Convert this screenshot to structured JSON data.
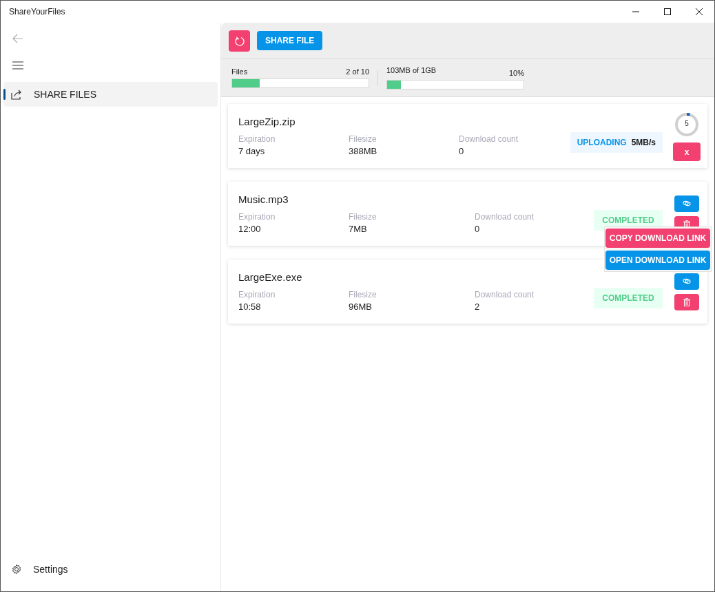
{
  "window": {
    "title": "ShareYourFiles"
  },
  "sidebar": {
    "items": [
      {
        "label": "SHARE FILES",
        "selected": true
      }
    ],
    "footer": {
      "label": "Settings"
    }
  },
  "toolbar": {
    "share_button": "SHARE FILE"
  },
  "stats": [
    {
      "label": "Files",
      "reading": "2 of 10",
      "level": 0.2
    },
    {
      "label": "103MB of 1GB",
      "reading": "10%",
      "level": 0.1
    }
  ],
  "files": [
    {
      "kind": "uploading",
      "name": "LargeZip.zip",
      "fields": [
        {
          "label": "Expiration",
          "value": "7 days"
        },
        {
          "label": "Filesize",
          "value": "388MB"
        },
        {
          "label": "Download count",
          "value": "0"
        }
      ],
      "status": "UPLOADING",
      "speed": "5MB/s",
      "progress": {
        "value": "5",
        "level": 0.05
      },
      "cancel": "x"
    },
    {
      "kind": "completed",
      "name": "Music.mp3",
      "fields": [
        {
          "label": "Expiration",
          "value": "12:00"
        },
        {
          "label": "Filesize",
          "value": "7MB"
        },
        {
          "label": "Download count",
          "value": "0"
        }
      ],
      "status": "COMPLETED"
    },
    {
      "kind": "completed",
      "name": "LargeExe.exe",
      "fields": [
        {
          "label": "Expiration",
          "value": "10:58"
        },
        {
          "label": "Filesize",
          "value": "96MB"
        },
        {
          "label": "Download count",
          "value": "2"
        }
      ],
      "status": "COMPLETED"
    }
  ],
  "link_menu": {
    "items": [
      "COPY DOWNLOAD LINK",
      "OPEN DOWNLOAD LINK"
    ]
  }
}
